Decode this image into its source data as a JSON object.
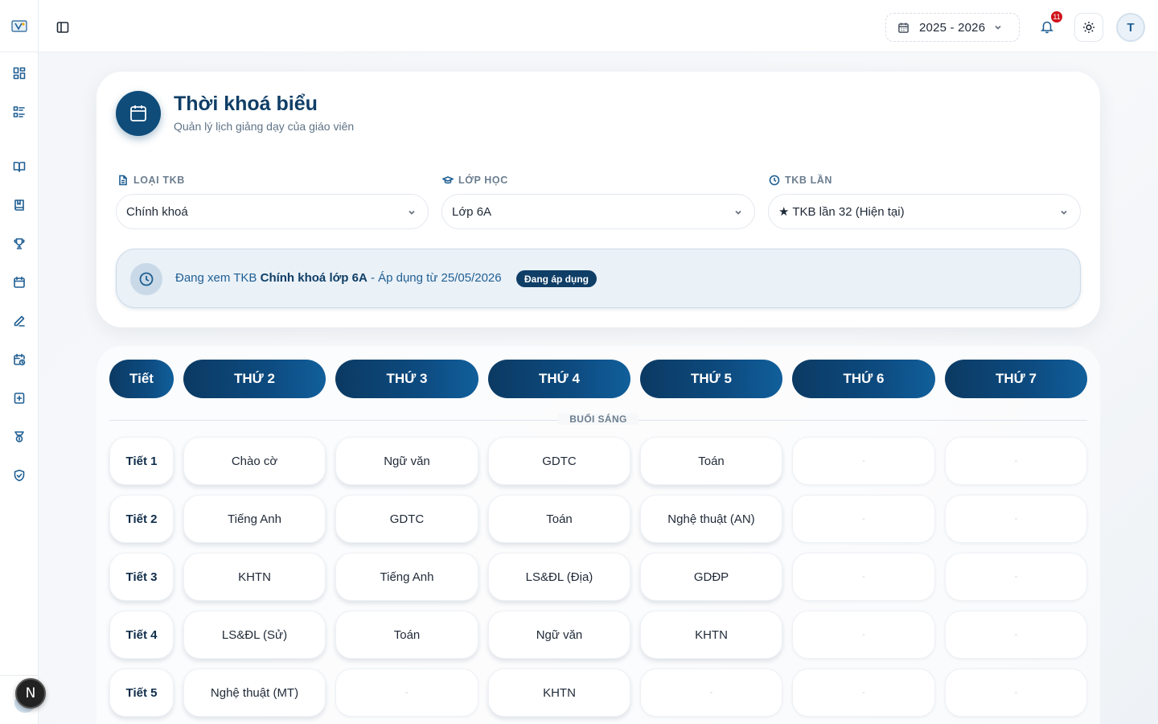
{
  "topbar": {
    "school_year": "2025 - 2026",
    "notification_count": "11",
    "avatar_initial": "T"
  },
  "sidebar": {
    "icons": [
      "dashboard-icon",
      "list-icon",
      "book-open-icon",
      "book-icon",
      "trophy-icon",
      "calendar-icon",
      "pen-icon",
      "calendar-clock-icon",
      "add-document-icon",
      "award-icon",
      "shield-check-icon"
    ],
    "next_badge": "N"
  },
  "header": {
    "title": "Thời khoá biểu",
    "subtitle": "Quản lý lịch giảng dạy của giáo viên"
  },
  "filters": {
    "type": {
      "label": "LOẠI TKB",
      "value": "Chính khoá"
    },
    "class": {
      "label": "LỚP HỌC",
      "value": "Lớp 6A"
    },
    "version": {
      "label": "TKB LẦN",
      "value": "★ TKB lần 32 (Hiện tại)"
    }
  },
  "info": {
    "prefix": "Đang xem TKB ",
    "highlight": "Chính khoá lớp 6A",
    "suffix": " - Áp dụng từ 25/05/2026",
    "badge": "Đang áp dụng"
  },
  "timetable": {
    "period_header": "Tiết",
    "days": [
      "THỨ 2",
      "THỨ 3",
      "THỨ 4",
      "THỨ 5",
      "THỨ 6",
      "THỨ 7"
    ],
    "session_label": "BUỔI SÁNG",
    "empty_mark": "-",
    "rows": [
      {
        "period": "Tiết 1",
        "subjects": [
          "Chào cờ",
          "Ngữ văn",
          "GDTC",
          "Toán",
          "",
          ""
        ]
      },
      {
        "period": "Tiết 2",
        "subjects": [
          "Tiếng Anh",
          "GDTC",
          "Toán",
          "Nghệ thuật (AN)",
          "",
          ""
        ]
      },
      {
        "period": "Tiết 3",
        "subjects": [
          "KHTN",
          "Tiếng Anh",
          "LS&ĐL (Địa)",
          "GDĐP",
          "",
          ""
        ]
      },
      {
        "period": "Tiết 4",
        "subjects": [
          "LS&ĐL (Sử)",
          "Toán",
          "Ngữ văn",
          "KHTN",
          "",
          ""
        ]
      },
      {
        "period": "Tiết 5",
        "subjects": [
          "Nghệ thuật (MT)",
          "",
          "KHTN",
          "",
          "",
          ""
        ]
      }
    ]
  }
}
